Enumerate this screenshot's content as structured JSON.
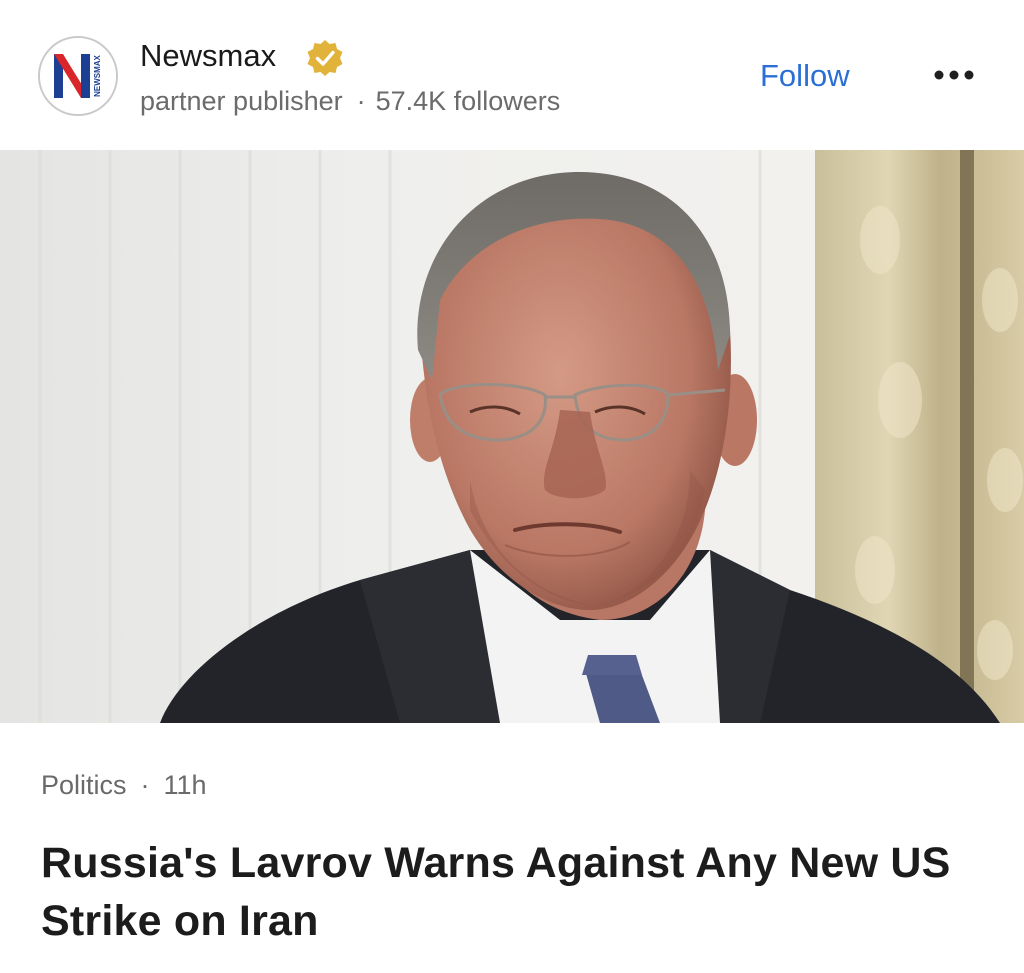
{
  "publisher": {
    "name": "Newsmax",
    "logo_letter": "N",
    "logo_text": "NEWSMAX",
    "type": "partner publisher",
    "followers": "57.4K followers",
    "verified": true,
    "follow_label": "Follow",
    "more_icon": "more-horizontal-icon"
  },
  "article": {
    "image_alt": "Sergei Lavrov",
    "category": "Politics",
    "separator": "·",
    "time": "11h",
    "headline": "Russia's Lavrov Warns Against Any New US Strike on Iran"
  },
  "colors": {
    "accent": "#2b6fd6",
    "logo_blue": "#1d3f93",
    "logo_red": "#d8262b",
    "badge_gold": "#e2b33a"
  }
}
